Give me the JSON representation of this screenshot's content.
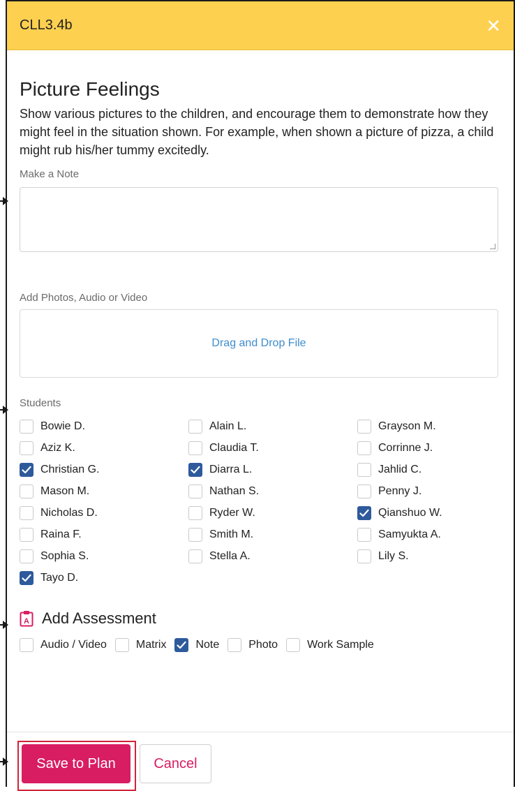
{
  "header": {
    "title": "CLL3.4b",
    "close_icon": "close-icon"
  },
  "activity": {
    "title": "Picture Feelings",
    "description": "Show various pictures to the children, and encourage them to demonstrate how they might feel in the situation shown. For example, when shown a picture of pizza, a child might rub his/her tummy excitedly."
  },
  "note": {
    "label": "Make a Note",
    "value": ""
  },
  "upload": {
    "label": "Add Photos, Audio or Video",
    "dropzone_text": "Drag and Drop File"
  },
  "students": {
    "label": "Students",
    "items": [
      {
        "name": "Bowie D.",
        "checked": false
      },
      {
        "name": "Alain L.",
        "checked": false
      },
      {
        "name": "Grayson M.",
        "checked": false
      },
      {
        "name": "Aziz K.",
        "checked": false
      },
      {
        "name": "Claudia T.",
        "checked": false
      },
      {
        "name": "Corrinne J.",
        "checked": false
      },
      {
        "name": "Christian G.",
        "checked": true
      },
      {
        "name": "Diarra L.",
        "checked": true
      },
      {
        "name": "Jahlid C.",
        "checked": false
      },
      {
        "name": "Mason M.",
        "checked": false
      },
      {
        "name": "Nathan S.",
        "checked": false
      },
      {
        "name": "Penny J.",
        "checked": false
      },
      {
        "name": "Nicholas D.",
        "checked": false
      },
      {
        "name": "Ryder W.",
        "checked": false
      },
      {
        "name": "Qianshuo W.",
        "checked": true
      },
      {
        "name": "Raina F.",
        "checked": false
      },
      {
        "name": "Smith M.",
        "checked": false
      },
      {
        "name": "Samyukta A.",
        "checked": false
      },
      {
        "name": "Sophia S.",
        "checked": false
      },
      {
        "name": "Stella A.",
        "checked": false
      },
      {
        "name": "Lily S.",
        "checked": false
      },
      {
        "name": "Tayo D.",
        "checked": true
      }
    ]
  },
  "assessment": {
    "title": "Add Assessment",
    "icon": "clipboard-assessment-icon",
    "options": [
      {
        "label": "Audio / Video",
        "checked": false
      },
      {
        "label": "Matrix",
        "checked": false
      },
      {
        "label": "Note",
        "checked": true
      },
      {
        "label": "Photo",
        "checked": false
      },
      {
        "label": "Work Sample",
        "checked": false
      }
    ]
  },
  "footer": {
    "save_label": "Save to Plan",
    "cancel_label": "Cancel"
  },
  "colors": {
    "header_bg": "#fed04f",
    "checkbox_checked": "#2e5a9c",
    "primary": "#d81d63",
    "link": "#3f8ccc",
    "highlight": "#d2233a"
  }
}
